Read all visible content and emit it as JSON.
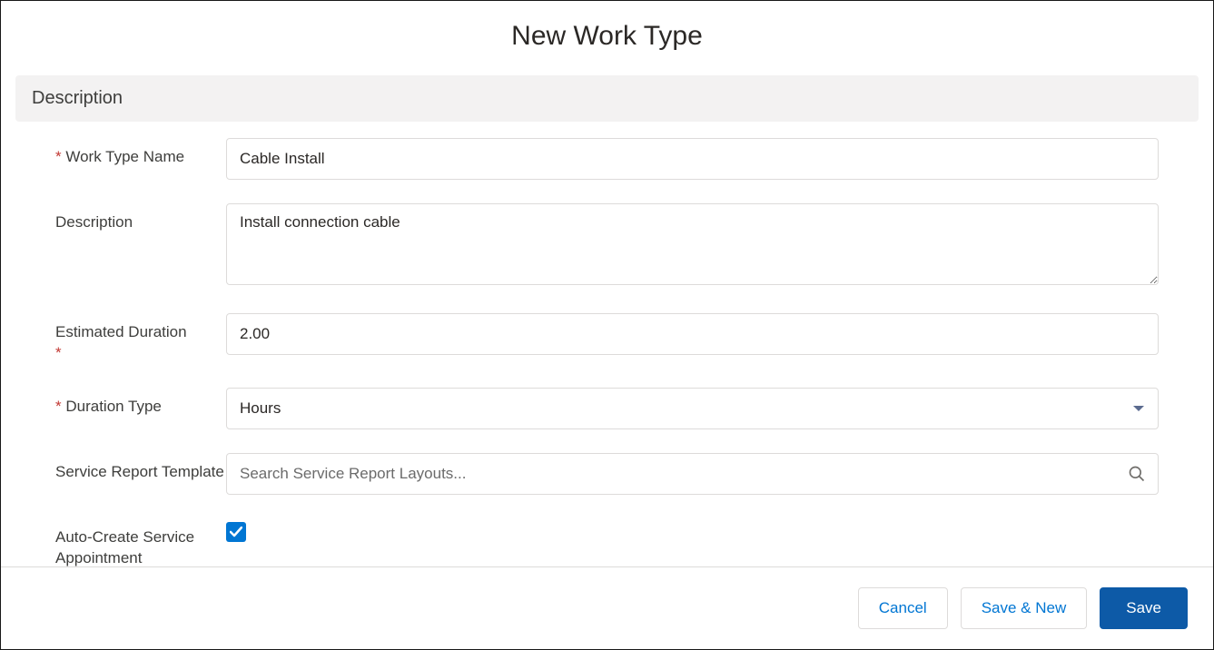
{
  "title": "New Work Type",
  "section": {
    "description_header": "Description"
  },
  "fields": {
    "work_type_name": {
      "label": "Work Type Name",
      "required": true,
      "value": "Cable Install"
    },
    "description": {
      "label": "Description",
      "required": false,
      "value": "Install connection cable"
    },
    "estimated_duration": {
      "label": "Estimated Duration",
      "required": true,
      "value": "2.00"
    },
    "duration_type": {
      "label": "Duration Type",
      "required": true,
      "value": "Hours"
    },
    "service_report_template": {
      "label": "Service Report Template",
      "required": false,
      "placeholder": "Search Service Report Layouts..."
    },
    "auto_create_service_appointment": {
      "label": "Auto-Create Service Appointment",
      "required": false,
      "checked": true
    }
  },
  "footer": {
    "cancel": "Cancel",
    "save_and_new": "Save & New",
    "save": "Save"
  }
}
